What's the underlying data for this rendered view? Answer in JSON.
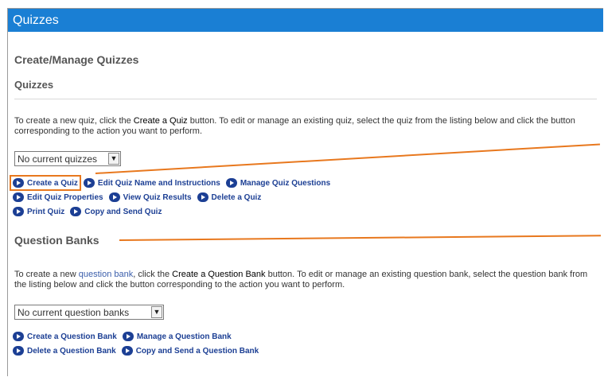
{
  "window": {
    "title": "Quizzes"
  },
  "page": {
    "heading": "Create/Manage Quizzes"
  },
  "quizzes": {
    "section_title": "Quizzes",
    "desc": {
      "p1": "To create a new quiz, click the ",
      "strong": "Create a Quiz",
      "p2": " button.  To edit or manage an existing quiz, select the quiz from the listing below and click the button corresponding to the action you want to perform."
    },
    "select_value": "No current quizzes",
    "actions": {
      "create": "Create a Quiz",
      "edit_name": "Edit Quiz Name and Instructions",
      "manage_questions": "Manage Quiz Questions",
      "edit_properties": "Edit Quiz Properties",
      "view_results": "View Quiz Results",
      "delete": "Delete a Quiz",
      "print": "Print Quiz",
      "copy_send": "Copy and Send Quiz"
    }
  },
  "banks": {
    "section_title": "Question Banks",
    "desc": {
      "p1": "To create a new ",
      "link": "question bank",
      "p2": ", click the ",
      "strong": "Create a Question Bank",
      "p3": " button.  To edit or manage an existing question bank, select the question bank from the listing below and click the button corresponding to the action you want to perform."
    },
    "select_value": "No current question banks",
    "actions": {
      "create": "Create a Question Bank",
      "manage": "Manage a Question Bank",
      "delete": "Delete a Question Bank",
      "copy_send": "Copy and Send a Question Bank"
    }
  },
  "colors": {
    "title_bar": "#1a7fd4",
    "accent": "#e8781e",
    "action_text": "#1c3f94"
  }
}
